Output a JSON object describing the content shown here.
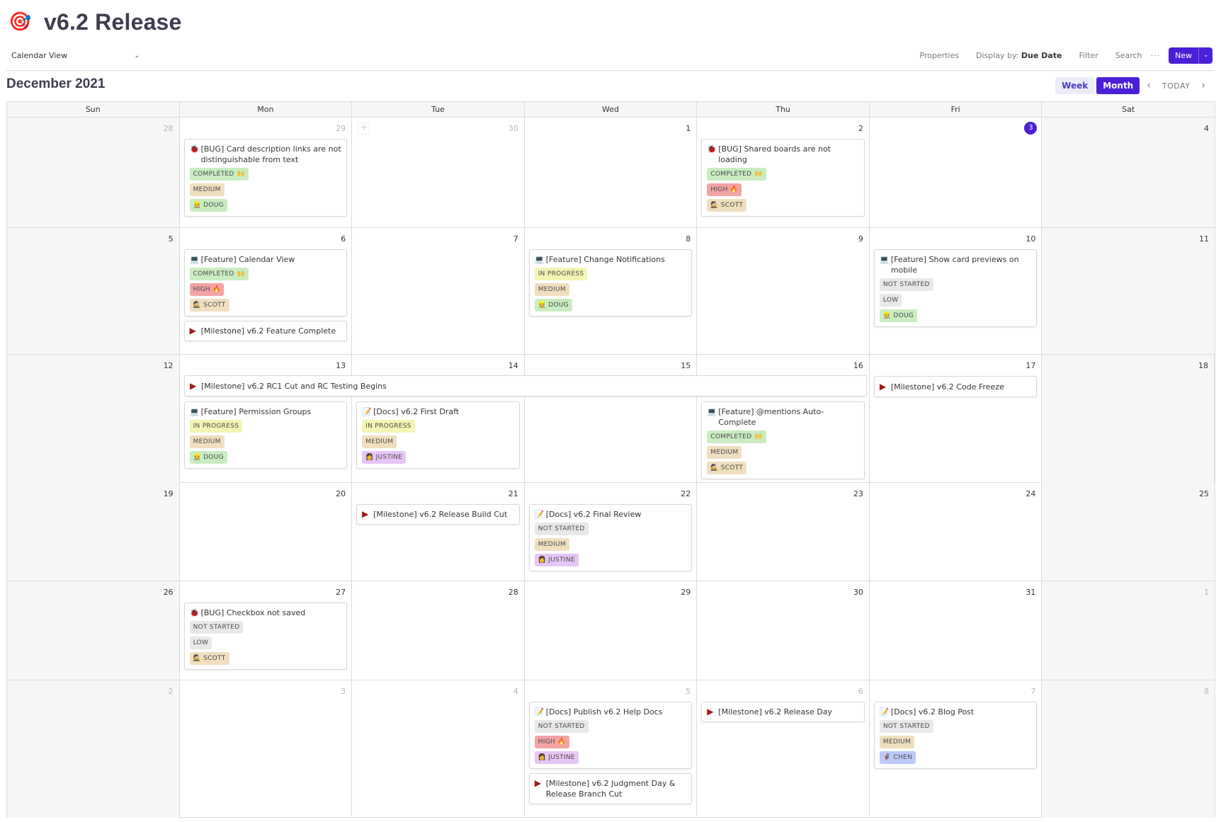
{
  "header": {
    "icon": "🎯",
    "title": "v6.2 Release"
  },
  "viewbar": {
    "view_label": "Calendar View",
    "properties": "Properties",
    "display_by_label": "Display by:",
    "display_by_value": "Due Date",
    "filter": "Filter",
    "search": "Search",
    "more": "···",
    "new_label": "New",
    "new_arrow": "⌄"
  },
  "calendar": {
    "month_title": "December 2021",
    "week_label": "Week",
    "month_label": "Month",
    "today_label": "TODAY",
    "prev": "‹",
    "next": "›",
    "add": "+",
    "weekdays": [
      "Sun",
      "Mon",
      "Tue",
      "Wed",
      "Thu",
      "Fri",
      "Sat"
    ]
  },
  "icons": {
    "bug": "🐞",
    "feature": "💻",
    "docs": "📝",
    "milestone": "▶",
    "completed": "🙌",
    "high": "🔥",
    "doug": "👷",
    "scott": "🕵",
    "justine": "👩",
    "chen": "🦸"
  },
  "weeks": [
    {
      "days": [
        {
          "num": "28",
          "other": true
        },
        {
          "num": "29",
          "other": true
        },
        {
          "num": "30",
          "other": true,
          "add": true
        },
        {
          "num": "1"
        },
        {
          "num": "2"
        },
        {
          "num": "3",
          "today": true
        },
        {
          "num": "4"
        }
      ]
    },
    {
      "days": [
        {
          "num": "5"
        },
        {
          "num": "6"
        },
        {
          "num": "7"
        },
        {
          "num": "8"
        },
        {
          "num": "9"
        },
        {
          "num": "10"
        },
        {
          "num": "11"
        }
      ]
    },
    {
      "days": [
        {
          "num": "12"
        },
        {
          "num": "13"
        },
        {
          "num": "14"
        },
        {
          "num": "15"
        },
        {
          "num": "16"
        },
        {
          "num": "17"
        },
        {
          "num": "18"
        }
      ]
    },
    {
      "days": [
        {
          "num": "19"
        },
        {
          "num": "20"
        },
        {
          "num": "21"
        },
        {
          "num": "22"
        },
        {
          "num": "23"
        },
        {
          "num": "24"
        },
        {
          "num": "25"
        }
      ]
    },
    {
      "days": [
        {
          "num": "26"
        },
        {
          "num": "27"
        },
        {
          "num": "28"
        },
        {
          "num": "29"
        },
        {
          "num": "30"
        },
        {
          "num": "31"
        },
        {
          "num": "1",
          "other": true
        }
      ]
    },
    {
      "days": [
        {
          "num": "2",
          "other": true
        },
        {
          "num": "3",
          "other": true
        },
        {
          "num": "4",
          "other": true
        },
        {
          "num": "5",
          "other": true
        },
        {
          "num": "6",
          "other": true
        },
        {
          "num": "7",
          "other": true
        },
        {
          "num": "8",
          "other": true
        }
      ]
    }
  ],
  "cards": {
    "c1": {
      "type": "bug",
      "title": "[BUG] Card description links are not distinguishable from text",
      "status": "COMPLETED",
      "priority": "MEDIUM",
      "assignee": "DOUG"
    },
    "c2": {
      "type": "bug",
      "title": "[BUG] Shared boards are not loading",
      "status": "COMPLETED",
      "priority": "HIGH",
      "assignee": "SCOTT"
    },
    "c3": {
      "type": "feature",
      "title": "[Feature] Calendar View",
      "status": "COMPLETED",
      "priority": "HIGH",
      "assignee": "SCOTT"
    },
    "c4": {
      "type": "milestone",
      "title": "[Milestone] v6.2 Feature Complete"
    },
    "c5": {
      "type": "feature",
      "title": "[Feature] Change Notifications",
      "status": "IN PROGRESS",
      "priority": "MEDIUM",
      "assignee": "DOUG"
    },
    "c6": {
      "type": "feature",
      "title": "[Feature] Show card previews on mobile",
      "status": "NOT STARTED",
      "priority": "LOW",
      "assignee": "DOUG"
    },
    "c7": {
      "type": "milestone",
      "title": "[Milestone] v6.2 RC1 Cut and RC Testing Begins"
    },
    "c8": {
      "type": "milestone",
      "title": "[Milestone] v6.2 Code Freeze"
    },
    "c9": {
      "type": "feature",
      "title": "[Feature] Permission Groups",
      "status": "IN PROGRESS",
      "priority": "MEDIUM",
      "assignee": "DOUG"
    },
    "c10": {
      "type": "docs",
      "title": "[Docs] v6.2 First Draft",
      "status": "IN PROGRESS",
      "priority": "MEDIUM",
      "assignee": "JUSTINE"
    },
    "c11": {
      "type": "feature",
      "title": "[Feature] @mentions Auto-Complete",
      "status": "COMPLETED",
      "priority": "MEDIUM",
      "assignee": "SCOTT"
    },
    "c12": {
      "type": "milestone",
      "title": "[Milestone] v6.2 Release Build Cut"
    },
    "c13": {
      "type": "docs",
      "title": "[Docs] v6.2 Final Review",
      "status": "NOT STARTED",
      "priority": "MEDIUM",
      "assignee": "JUSTINE"
    },
    "c14": {
      "type": "bug",
      "title": "[BUG] Checkbox not saved",
      "status": "NOT STARTED",
      "priority": "LOW",
      "assignee": "SCOTT"
    },
    "c15": {
      "type": "docs",
      "title": "[Docs] Publish v6.2 Help Docs",
      "status": "NOT STARTED",
      "priority": "HIGH",
      "assignee": "JUSTINE"
    },
    "c16": {
      "type": "milestone",
      "title": "[Milestone] v6.2 Judgment Day & Release Branch Cut"
    },
    "c17": {
      "type": "milestone",
      "title": "[Milestone] v6.2 Release Day"
    },
    "c18": {
      "type": "docs",
      "title": "[Docs] v6.2 Blog Post",
      "status": "NOT STARTED",
      "priority": "MEDIUM",
      "assignee": "CHEN"
    }
  },
  "colors": {
    "accent": "#4a1fd6",
    "completed": "#c9edc0",
    "in_progress": "#f2f5b3",
    "not_started": "#e8e8e8",
    "medium": "#f0dfbf",
    "high": "#f2a3a3",
    "milestone_flag": "#a11a1a"
  }
}
